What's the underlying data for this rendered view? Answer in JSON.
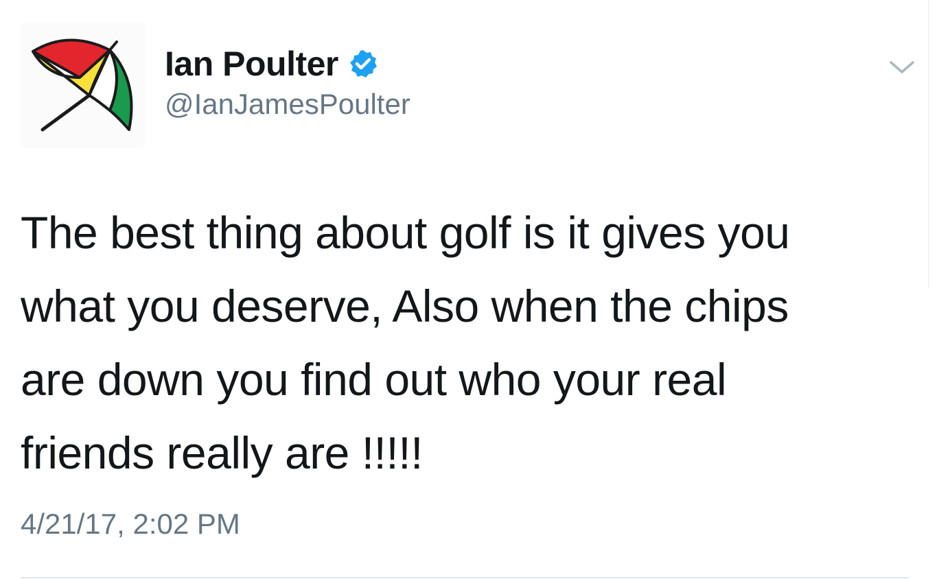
{
  "tweet": {
    "author": {
      "display_name": "Ian Poulter",
      "handle": "@IanJamesPoulter",
      "verified": true,
      "avatar_icon": "umbrella-logo-icon"
    },
    "text_lines": [
      "The best thing about golf is it gives you",
      "what you deserve, Also when the chips",
      "are down you find out who your real",
      "friends really are !!!!!"
    ],
    "timestamp": "4/21/17, 2:02 PM",
    "menu_icon": "chevron-down-icon"
  },
  "colors": {
    "primary_text": "#14171a",
    "secondary_text": "#657786",
    "verified_blue": "#1da1f2",
    "umbrella_red": "#e3262e",
    "umbrella_yellow": "#f6e23b",
    "umbrella_green": "#1a9a4f"
  }
}
